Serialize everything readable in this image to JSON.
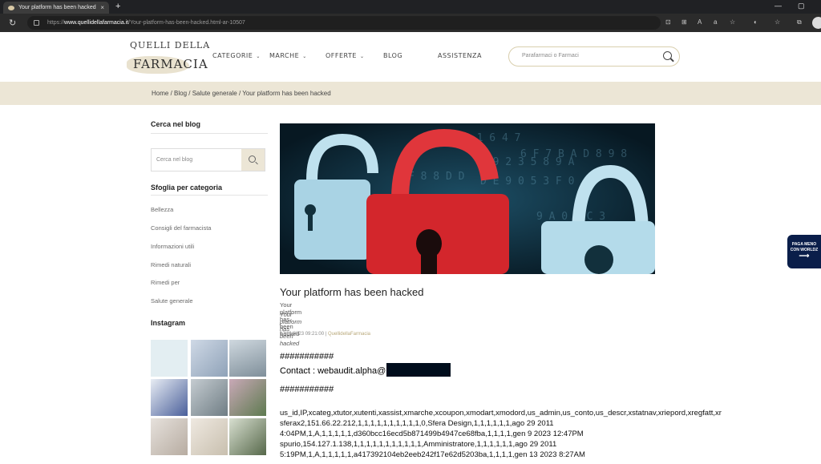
{
  "browser": {
    "tab_title": "Your platform has been hacked",
    "tab_close": "×",
    "new_tab": "+",
    "url_prefix": "https://",
    "url_host": "www.quellidellafarmacia.it",
    "url_path": "/Your-platform-has-been-hacked.html-ar-10507"
  },
  "site": {
    "logo_top": "QUELLI DELLA",
    "logo_bottom": "FARMACIA",
    "nav": [
      {
        "label": "CATEGORIE",
        "has_dropdown": true
      },
      {
        "label": "MARCHE",
        "has_dropdown": true
      },
      {
        "label": "OFFERTE",
        "has_dropdown": true
      },
      {
        "label": "BLOG",
        "has_dropdown": false
      },
      {
        "label": "ASSISTENZA",
        "has_dropdown": false
      }
    ],
    "search_placeholder": "Parafarmaci o Farmaci"
  },
  "breadcrumb": {
    "items": [
      "Home",
      "Blog",
      "Salute generale",
      "Your platform has been hacked"
    ],
    "text": "Home / Blog / Salute generale / Your platform has been hacked"
  },
  "sidebar": {
    "search_title": "Cerca nel blog",
    "search_placeholder": "Cerca nel blog",
    "categories_title": "Sfoglia per categoria",
    "categories": [
      "Bellezza",
      "Consigli del farmacista",
      "Informazioni utili",
      "Rimedi naturali",
      "Rimedi per",
      "Salute generale"
    ],
    "instagram_title": "Instagram"
  },
  "post": {
    "title": "Your platform has been hacked",
    "subtitle": "Your platform has been hacked",
    "subtitle_italic": "Your platform has been hacked",
    "date": "17/01/2023 09:21:00",
    "separator": "|",
    "author": "QuellidellaFarmacia",
    "hashes": "###########",
    "contact": "Contact : webaudit.alpha@",
    "csv_lines": [
      "us_id,IP,xcateg,xtutor,xutenti,xassist,xmarche,xcoupon,xmodart,xmodord,us_admin,us_conto,us_descr,xstatnav,xriepord,xregfatt,xr",
      "sferax2,151.66.22.212,1,1,1,1,1,1,1,1,1,1,0,Sfera Design,1,1,1,1,1,1,ago 29 2011",
      " 4:04PM,1,A,1,1,1,1,1,d360bcc16ecd5b871499b4947ce68fba,1,1,1,1,gen  9 2023 12:47PM",
      "spurio,154.127.1.138,1,1,1,1,1,1,1,1,1,1,1,Amministratore,1,1,1,1,1,1,ago 29 2011",
      " 5:19PM,1,A,1,1,1,1,1,a417392104eb2eeb242f17e62d5203ba,1,1,1,1,gen 13 2023  8:27AM"
    ]
  },
  "widget": {
    "line1": "PAGA MENO",
    "line2": "CON WORLDZ"
  }
}
